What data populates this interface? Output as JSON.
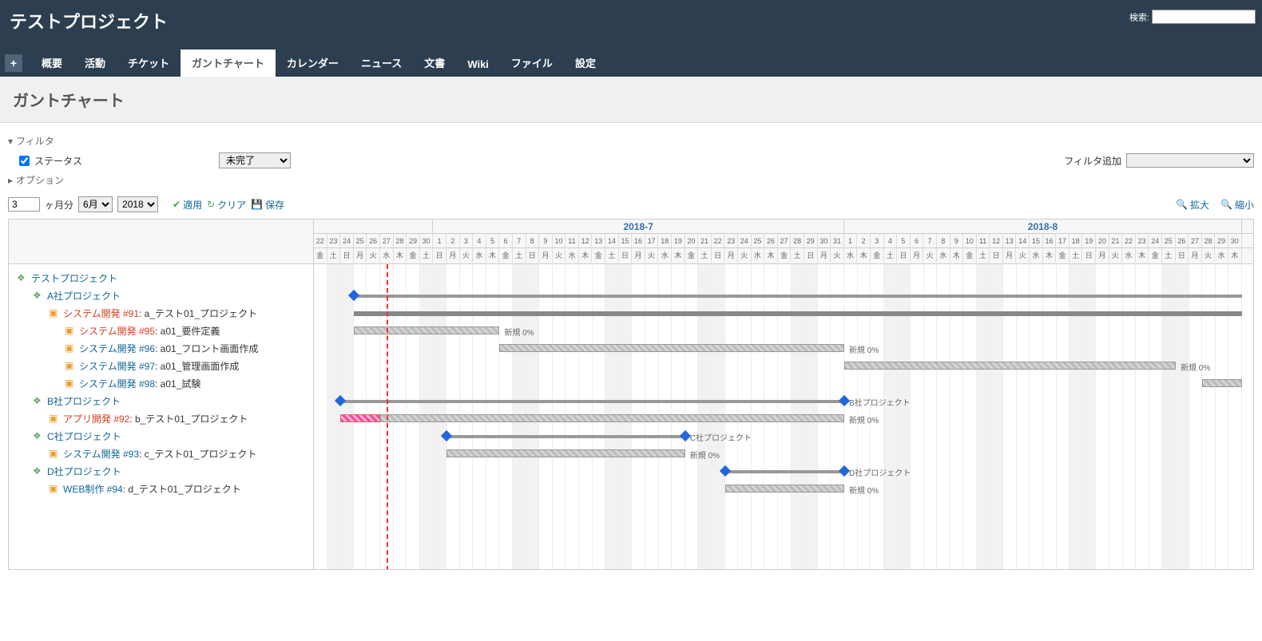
{
  "header": {
    "title": "テストプロジェクト",
    "search_label": "検索:"
  },
  "tabs": {
    "new": "+",
    "items": [
      "概要",
      "活動",
      "チケット",
      "ガントチャート",
      "カレンダー",
      "ニュース",
      "文書",
      "Wiki",
      "ファイル",
      "設定"
    ],
    "active": 3
  },
  "page_title": "ガントチャート",
  "filters": {
    "section_label": "フィルタ",
    "status_label": "ステータス",
    "status_value": "未完了",
    "add_label": "フィルタ追加",
    "options_label": "オプション"
  },
  "toolbar": {
    "months_value": "3",
    "months_unit": "ヶ月分",
    "month_select": "6月",
    "year_select": "2018",
    "apply": "適用",
    "clear": "クリア",
    "save": "保存",
    "zoom_in": "拡大",
    "zoom_out": "縮小"
  },
  "tree": [
    {
      "indent": 0,
      "icon": "proj",
      "links": [
        {
          "t": "テストプロジェクト",
          "c": "blue"
        }
      ]
    },
    {
      "indent": 1,
      "icon": "proj",
      "links": [
        {
          "t": "A社プロジェクト",
          "c": "blue"
        }
      ]
    },
    {
      "indent": 2,
      "icon": "box",
      "links": [
        {
          "t": "システム開発 #91",
          "c": "red"
        },
        {
          "t": ": a_テスト01_プロジェクト",
          "c": "txt"
        }
      ]
    },
    {
      "indent": 3,
      "icon": "box",
      "links": [
        {
          "t": "システム開発 #95",
          "c": "red"
        },
        {
          "t": ": a01_要件定義",
          "c": "txt"
        }
      ]
    },
    {
      "indent": 3,
      "icon": "box",
      "links": [
        {
          "t": "システム開発 #96",
          "c": "blue"
        },
        {
          "t": ": a01_フロント画面作成",
          "c": "txt"
        }
      ]
    },
    {
      "indent": 3,
      "icon": "box",
      "links": [
        {
          "t": "システム開発 #97",
          "c": "blue"
        },
        {
          "t": ": a01_管理画面作成",
          "c": "txt"
        }
      ]
    },
    {
      "indent": 3,
      "icon": "box",
      "links": [
        {
          "t": "システム開発 #98",
          "c": "blue"
        },
        {
          "t": ": a01_試験",
          "c": "txt"
        }
      ]
    },
    {
      "indent": 1,
      "icon": "proj",
      "links": [
        {
          "t": "B社プロジェクト",
          "c": "blue"
        }
      ]
    },
    {
      "indent": 2,
      "icon": "box",
      "links": [
        {
          "t": "アプリ開発 #92",
          "c": "red"
        },
        {
          "t": ": b_テスト01_プロジェクト",
          "c": "txt"
        }
      ]
    },
    {
      "indent": 1,
      "icon": "proj",
      "links": [
        {
          "t": "C社プロジェクト",
          "c": "blue"
        }
      ]
    },
    {
      "indent": 2,
      "icon": "box",
      "links": [
        {
          "t": "システム開発 #93",
          "c": "blue"
        },
        {
          "t": ": c_テスト01_プロジェクト",
          "c": "txt"
        }
      ]
    },
    {
      "indent": 1,
      "icon": "proj",
      "links": [
        {
          "t": "D社プロジェクト",
          "c": "blue"
        }
      ]
    },
    {
      "indent": 2,
      "icon": "box",
      "links": [
        {
          "t": "WEB制作 #94",
          "c": "blue"
        },
        {
          "t": ": d_テスト01_プロジェクト",
          "c": "txt"
        }
      ]
    }
  ],
  "chart_data": {
    "type": "gantt",
    "timeline": {
      "start": "2018-06-22",
      "end": "2018-08-30",
      "today": "2018-06-27",
      "months": [
        {
          "label": "",
          "days": 9
        },
        {
          "label": "2018-7",
          "days": 31
        },
        {
          "label": "2018-8",
          "days": 30
        }
      ],
      "day_numbers": [
        22,
        23,
        24,
        25,
        26,
        27,
        28,
        29,
        30,
        1,
        2,
        3,
        4,
        5,
        6,
        7,
        8,
        9,
        10,
        11,
        12,
        13,
        14,
        15,
        16,
        17,
        18,
        19,
        20,
        21,
        22,
        23,
        24,
        25,
        26,
        27,
        28,
        29,
        30,
        31,
        1,
        2,
        3,
        4,
        5,
        6,
        7,
        8,
        9,
        10,
        11,
        12,
        13,
        14,
        15,
        16,
        17,
        18,
        19,
        20,
        21,
        22,
        23,
        24,
        25,
        26,
        27,
        28,
        29,
        30
      ],
      "dow": [
        "金",
        "土",
        "日",
        "月",
        "火",
        "水",
        "木",
        "金",
        "土",
        "日",
        "月",
        "火",
        "水",
        "木",
        "金",
        "土",
        "日",
        "月",
        "火",
        "水",
        "木",
        "金",
        "土",
        "日",
        "月",
        "火",
        "水",
        "木",
        "金",
        "土",
        "日",
        "月",
        "火",
        "水",
        "木",
        "金",
        "土",
        "日",
        "月",
        "火",
        "水",
        "木",
        "金",
        "土",
        "日",
        "月",
        "火",
        "水",
        "木",
        "金",
        "土",
        "日",
        "月",
        "火",
        "水",
        "木",
        "金",
        "土",
        "日",
        "月",
        "火",
        "水",
        "木",
        "金",
        "土",
        "日",
        "月",
        "火",
        "水",
        "木"
      ],
      "weekends": [
        1,
        2,
        8,
        9,
        15,
        16,
        22,
        23,
        29,
        30,
        36,
        37,
        43,
        44,
        50,
        51,
        57,
        58,
        64,
        65
      ]
    },
    "rows": [
      {
        "row": 0
      },
      {
        "row": 1,
        "diamonds": [
          3
        ],
        "summary": {
          "start": 3,
          "end": 70
        }
      },
      {
        "row": 2,
        "bar": {
          "start": 3,
          "end": 70,
          "type": "solid"
        }
      },
      {
        "row": 3,
        "bar": {
          "start": 3,
          "end": 14,
          "type": "hatch"
        },
        "label": "新規 0%"
      },
      {
        "row": 4,
        "bar": {
          "start": 14,
          "end": 40,
          "type": "hatch"
        },
        "label": "新規 0%"
      },
      {
        "row": 5,
        "bar": {
          "start": 40,
          "end": 65,
          "type": "hatch"
        },
        "label": "新規 0%"
      },
      {
        "row": 6,
        "bar": {
          "start": 67,
          "end": 70,
          "type": "hatch"
        }
      },
      {
        "row": 7,
        "diamonds": [
          2,
          40
        ],
        "summary": {
          "start": 2,
          "end": 40
        },
        "label": "B社プロジェクト"
      },
      {
        "row": 8,
        "bar": {
          "start": 2,
          "end": 5,
          "type": "red"
        },
        "bar2": {
          "start": 5,
          "end": 40,
          "type": "hatch"
        },
        "label": "新規 0%"
      },
      {
        "row": 9,
        "diamonds": [
          10,
          28
        ],
        "summary": {
          "start": 10,
          "end": 28
        },
        "label": "C社プロジェクト"
      },
      {
        "row": 10,
        "bar": {
          "start": 10,
          "end": 28,
          "type": "hatch"
        },
        "label": "新規 0%"
      },
      {
        "row": 11,
        "diamonds": [
          31,
          40
        ],
        "summary": {
          "start": 31,
          "end": 40
        },
        "label": "D社プロジェクト"
      },
      {
        "row": 12,
        "bar": {
          "start": 31,
          "end": 40,
          "type": "hatch"
        },
        "label": "新規 0%"
      }
    ],
    "status_text": "新規 0%"
  }
}
